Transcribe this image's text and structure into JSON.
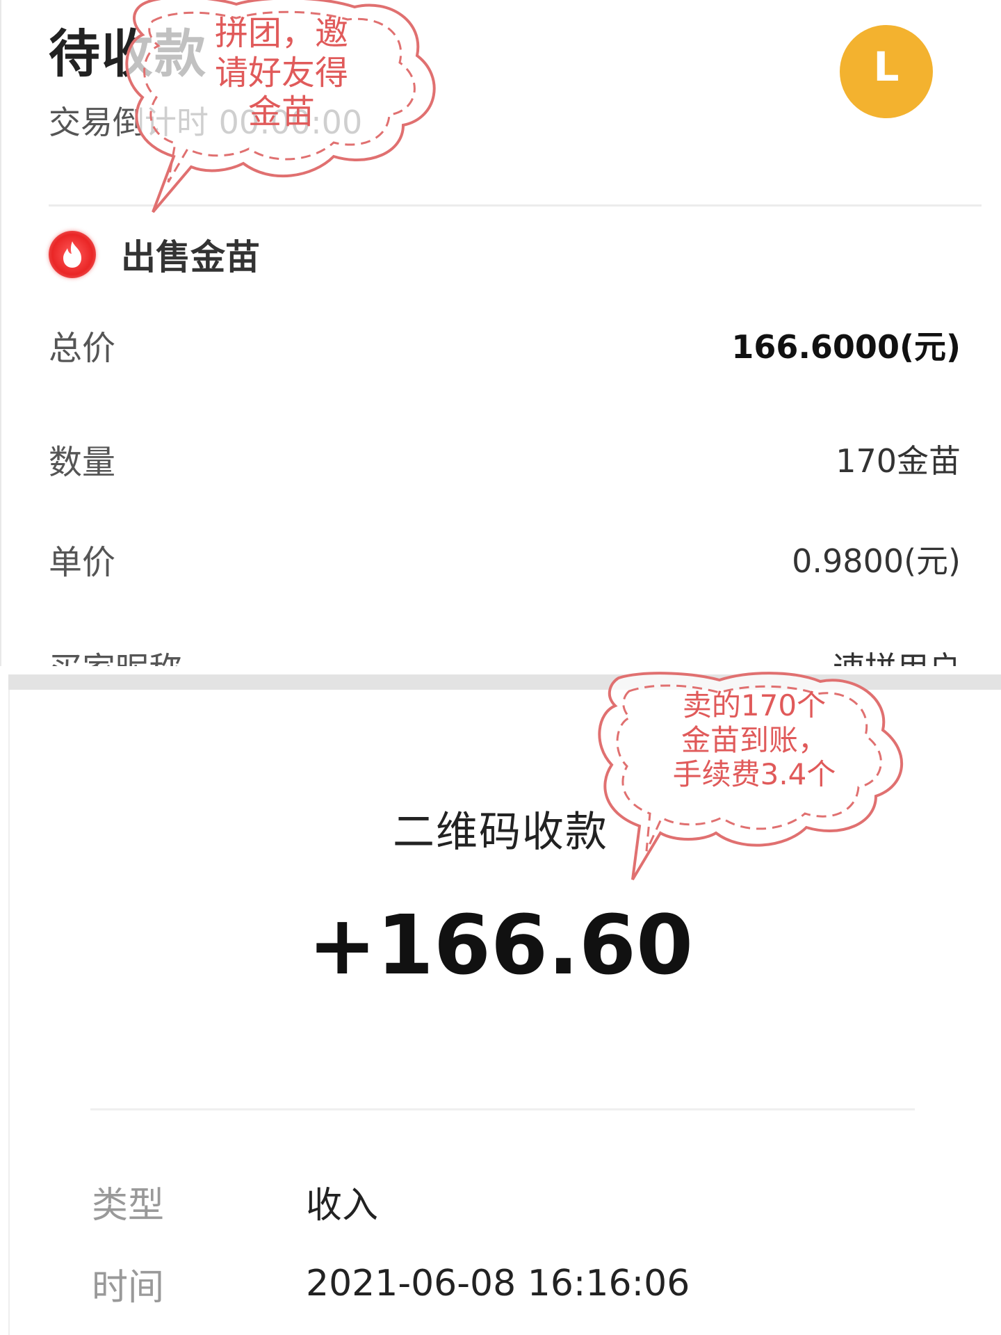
{
  "order": {
    "status_title": "待收款",
    "countdown": "交易倒计时 00:00:00",
    "avatar_letter": "L",
    "section_title": "出售金苗",
    "rows": [
      {
        "label": "总价",
        "value": "166.6000(元)"
      },
      {
        "label": "数量",
        "value": "170金苗"
      },
      {
        "label": "单价",
        "value": "0.9800(元)"
      },
      {
        "label": "买家昵称",
        "value": "速拼用户"
      }
    ]
  },
  "payment": {
    "title": "二维码收款",
    "amount": "+166.60",
    "details": [
      {
        "label": "类型",
        "value": "收入"
      },
      {
        "label": "时间",
        "value": "2021-06-08 16:16:06"
      }
    ]
  },
  "annotations": {
    "bubble1": [
      "拼团，邀",
      "请好友得",
      "金苗"
    ],
    "bubble2": [
      "卖的170个",
      "金苗到账，",
      "手续费3.4个"
    ]
  },
  "colors": {
    "avatar": "#f3b22f",
    "fire": "#ea2626",
    "annotation": "#e05a5a"
  }
}
